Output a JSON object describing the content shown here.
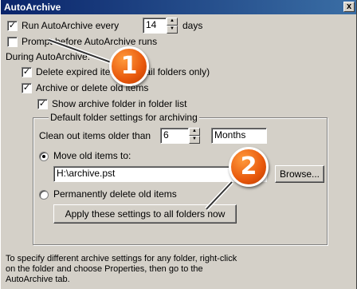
{
  "window": {
    "title": "AutoArchive",
    "close_glyph": "x"
  },
  "run": {
    "label": "Run AutoArchive every",
    "value": "14",
    "unit": "days",
    "checked": true
  },
  "prompt": {
    "label": "Prompt before AutoArchive runs",
    "checked": false
  },
  "during_label": "During AutoArchive:",
  "delete_expired": {
    "label": "Delete expired items (e-mail folders only)",
    "checked": true
  },
  "archive_old": {
    "label": "Archive or delete old items",
    "checked": true
  },
  "show_folder": {
    "label": "Show archive folder in folder list",
    "checked": true
  },
  "group": {
    "label": "Default folder settings for archiving",
    "clean_label": "Clean out items older than",
    "clean_value": "6",
    "clean_unit": "Months"
  },
  "move": {
    "label": "Move old items to:",
    "path": "H:\\archive.pst",
    "browse_label": "Browse..."
  },
  "permanent": {
    "label": "Permanently delete old items"
  },
  "apply_label": "Apply these settings to all folders now",
  "info_text": [
    "To specify different archive settings for any folder, right-click",
    "on the folder and choose Properties, then go to the",
    "AutoArchive tab."
  ],
  "callouts": [
    "1",
    "2"
  ],
  "colors": {
    "title_start": "#0a246a",
    "title_end": "#3a6ea5",
    "dialog": "#d4d0c8",
    "callout": "#e8580c"
  }
}
